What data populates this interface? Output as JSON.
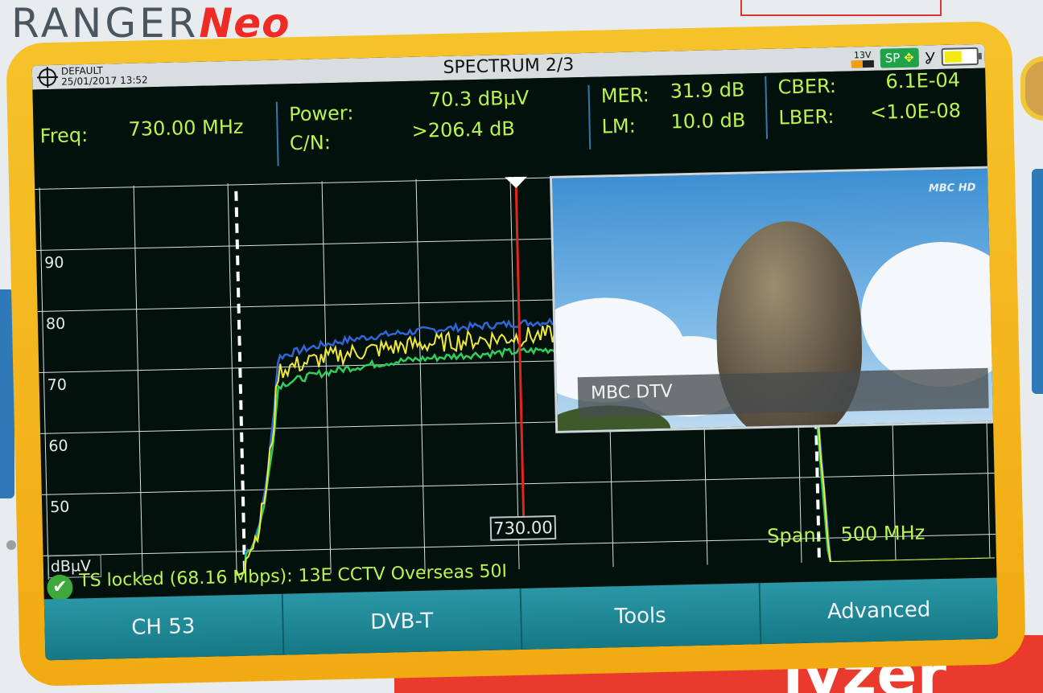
{
  "brand": {
    "prefix": "RANGER",
    "suffix": "Neo"
  },
  "banner": {
    "text": "lyzer"
  },
  "header": {
    "title": "SPECTRUM 2/3",
    "profile": "DEFAULT",
    "datetime": "25/01/2017 13:52",
    "voltage": "13V",
    "mode": "SP",
    "mode_icon": "move-arrows-icon",
    "antenna_icon": "antenna-icon",
    "battery_level": 0.55
  },
  "measurements": {
    "freq_label": "Freq:",
    "freq_value": "730.00 MHz",
    "power_label": "Power:",
    "power_value": "70.3 dBµV",
    "cn_label": "C/N:",
    "cn_value": ">206.4 dB",
    "mer_label": "MER:",
    "mer_value": "31.9 dB",
    "lm_label": "LM:",
    "lm_value": "10.0 dB",
    "cber_label": "CBER:",
    "cber_value": "6.1E-04",
    "lber_label": "LBER:",
    "lber_value": "<1.0E-08"
  },
  "spectrum": {
    "y_ticks": [
      "90",
      "80",
      "70",
      "60",
      "50"
    ],
    "unit": "dBµV",
    "marker_value": "730.00",
    "span_label": "Span:",
    "span_value": "500 MHz",
    "colors": {
      "max": "#2f66d8",
      "current": "#f2e83a",
      "min": "#2fd05a",
      "marker": "#e3261b"
    }
  },
  "video": {
    "logo": "MBC HD",
    "channel_name": "MBC DTV"
  },
  "ts_status": {
    "icon": "check-icon",
    "text": "TS locked (68.16 Mbps): 13E CCTV  Overseas 50I"
  },
  "softkeys": [
    "CH 53",
    "DVB-T",
    "Tools",
    "Advanced"
  ]
}
